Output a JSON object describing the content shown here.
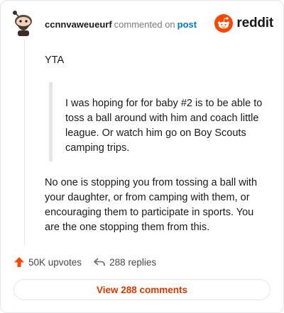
{
  "header": {
    "username": "ccnnvaweueurf",
    "commented_text": "commented on",
    "post_link": "post",
    "brand": "reddit"
  },
  "comment": {
    "intro": "YTA",
    "quote": "I was hoping for for baby #2 is to be able to toss a ball around with him and coach little league. Or watch him go on Boy Scouts camping trips.",
    "reply": "No one is stopping you from tossing a ball with your daughter, or from camping with them, or encouraging them to participate in sports. You are the one stopping them from this."
  },
  "actions": {
    "upvotes": "50K upvotes",
    "replies": "288 replies"
  },
  "view_button": "View 288 comments",
  "colors": {
    "accent": "#d93900",
    "brand": "#ff4500",
    "link": "#0079d3"
  },
  "icons": [
    "avatar",
    "reddit-logo-icon",
    "upvote-arrow-icon",
    "reply-arrow-icon"
  ]
}
